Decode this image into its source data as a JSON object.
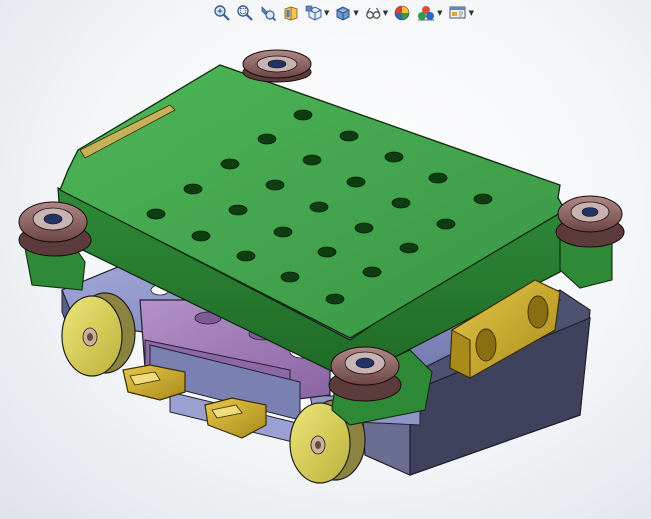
{
  "toolbar": {
    "buttons": [
      {
        "id": "zoom-to-fit",
        "icon": "zoom-to-fit-icon",
        "dropdown": false
      },
      {
        "id": "zoom-to-area",
        "icon": "zoom-to-area-icon",
        "dropdown": false
      },
      {
        "id": "previous-view",
        "icon": "previous-view-icon",
        "dropdown": false
      },
      {
        "id": "section-view",
        "icon": "section-view-icon",
        "dropdown": false
      },
      {
        "id": "view-orientation",
        "icon": "view-orientation-icon",
        "dropdown": true
      },
      {
        "id": "display-style",
        "icon": "display-style-icon",
        "dropdown": true
      },
      {
        "id": "hide-show-items",
        "icon": "hide-show-items-icon",
        "dropdown": true
      },
      {
        "id": "edit-appearance",
        "icon": "edit-appearance-icon",
        "dropdown": false
      },
      {
        "id": "apply-scene",
        "icon": "apply-scene-icon",
        "dropdown": true
      },
      {
        "id": "view-settings",
        "icon": "view-settings-icon",
        "dropdown": true
      }
    ]
  },
  "model": {
    "colors": {
      "top_plate": "#3f9f4a",
      "top_plate_shade": "#2f7d37",
      "bearing": "#7a5252",
      "base_block": "#8087b8",
      "slider_block": "#9a77b0",
      "wheel": "#c9c44a",
      "brass_part": "#c8a826",
      "dark_base": "#5a5f78"
    }
  }
}
